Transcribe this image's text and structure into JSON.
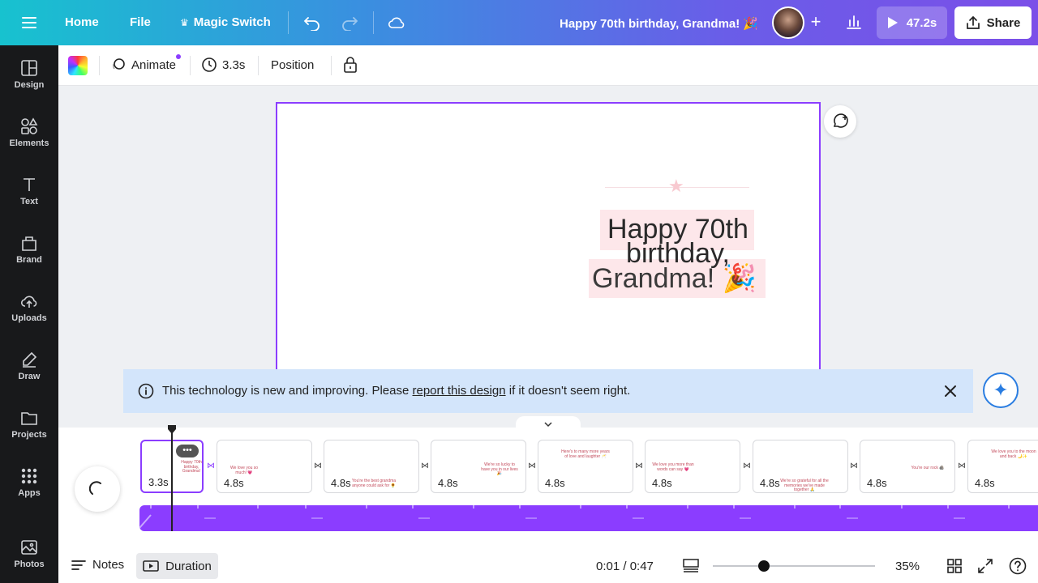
{
  "topbar": {
    "menu_icon": "hamburger-icon",
    "home": "Home",
    "file": "File",
    "magic_switch": "Magic Switch",
    "title": "Happy 70th birthday, Grandma! 🎉",
    "play_time": "47.2s",
    "share": "Share"
  },
  "sidebar": {
    "items": [
      {
        "label": "Design",
        "icon": "design-icon"
      },
      {
        "label": "Elements",
        "icon": "elements-icon"
      },
      {
        "label": "Text",
        "icon": "text-icon"
      },
      {
        "label": "Brand",
        "icon": "brand-icon"
      },
      {
        "label": "Uploads",
        "icon": "uploads-icon"
      },
      {
        "label": "Draw",
        "icon": "draw-icon"
      },
      {
        "label": "Projects",
        "icon": "projects-icon"
      },
      {
        "label": "Apps",
        "icon": "apps-icon"
      },
      {
        "label": "Photos",
        "icon": "photos-icon"
      }
    ]
  },
  "toolbar": {
    "animate": "Animate",
    "duration": "3.3s",
    "position": "Position"
  },
  "canvas": {
    "line1": "Happy 70th",
    "line2": "birthday,",
    "line3": "Grandma! 🎉"
  },
  "banner": {
    "text_before": "This technology is new and improving. Please ",
    "link": "report this design",
    "text_after": " if it doesn't seem right."
  },
  "timeline": {
    "clips": [
      {
        "duration": "3.3s",
        "mini": "Happy 70th birthday, Grandma!"
      },
      {
        "duration": "4.8s",
        "mini": "We love you so much! 💗"
      },
      {
        "duration": "4.8s",
        "mini": "You're the best grandma anyone could ask for 🌻"
      },
      {
        "duration": "4.8s",
        "mini": "We're so lucky to have you in our lives 🎉"
      },
      {
        "duration": "4.8s",
        "mini": "Here's to many more years of love and laughter 🥂"
      },
      {
        "duration": "4.8s",
        "mini": "We love you more than words can say 💗"
      },
      {
        "duration": "4.8s",
        "mini": "We're so grateful for all the memories we've made together 🙏"
      },
      {
        "duration": "4.8s",
        "mini": "You're our rock 🪨"
      },
      {
        "duration": "4.8s",
        "mini": "We love you to the moon and back 🌙✨"
      }
    ]
  },
  "bottombar": {
    "notes": "Notes",
    "duration": "Duration",
    "time": "0:01 / 0:47",
    "zoom": "35%",
    "zoom_level": 0.35
  },
  "colors": {
    "accent": "#8b3dff",
    "banner_bg": "#d3e5fb",
    "sidebar_bg": "#18191b"
  }
}
